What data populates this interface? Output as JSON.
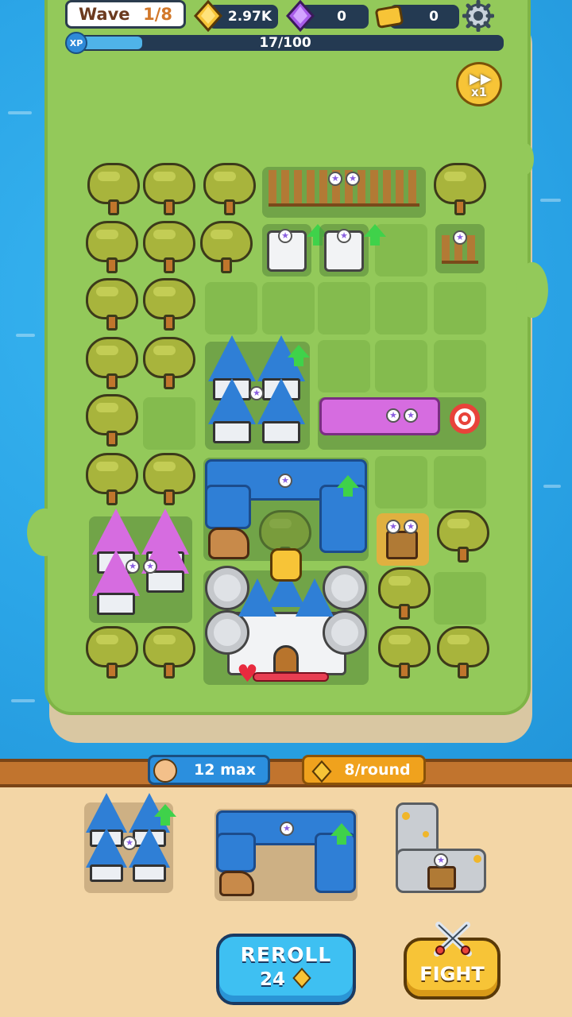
{
  "hud": {
    "wave_label": "Wave",
    "wave_value": "1/8",
    "gold": "2.97K",
    "gems": "0",
    "tickets": "0",
    "xp_label": "XP",
    "xp_text": "17/100",
    "xp_progress": 0.17,
    "speed_label": "x1",
    "icons": [
      "gold-gem-icon",
      "purple-gem-icon",
      "ticket-icon",
      "gear-icon",
      "fast-forward-icon"
    ]
  },
  "shop": {
    "population_text": "12 max",
    "income_text": "8/round",
    "reroll_label": "REROLL",
    "reroll_cost": "24",
    "fight_label": "FIGHT",
    "cards": [
      "blue-tower-cluster",
      "blue-stable-wall",
      "gold-mine-path"
    ]
  },
  "colors": {
    "water": "#2ba5e7",
    "grass": "#93c95a",
    "blue_roof": "#2f7fd6",
    "pink_roof": "#d66ce0",
    "gold": "#f7c437",
    "shop_bg": "#f3d6a6"
  }
}
